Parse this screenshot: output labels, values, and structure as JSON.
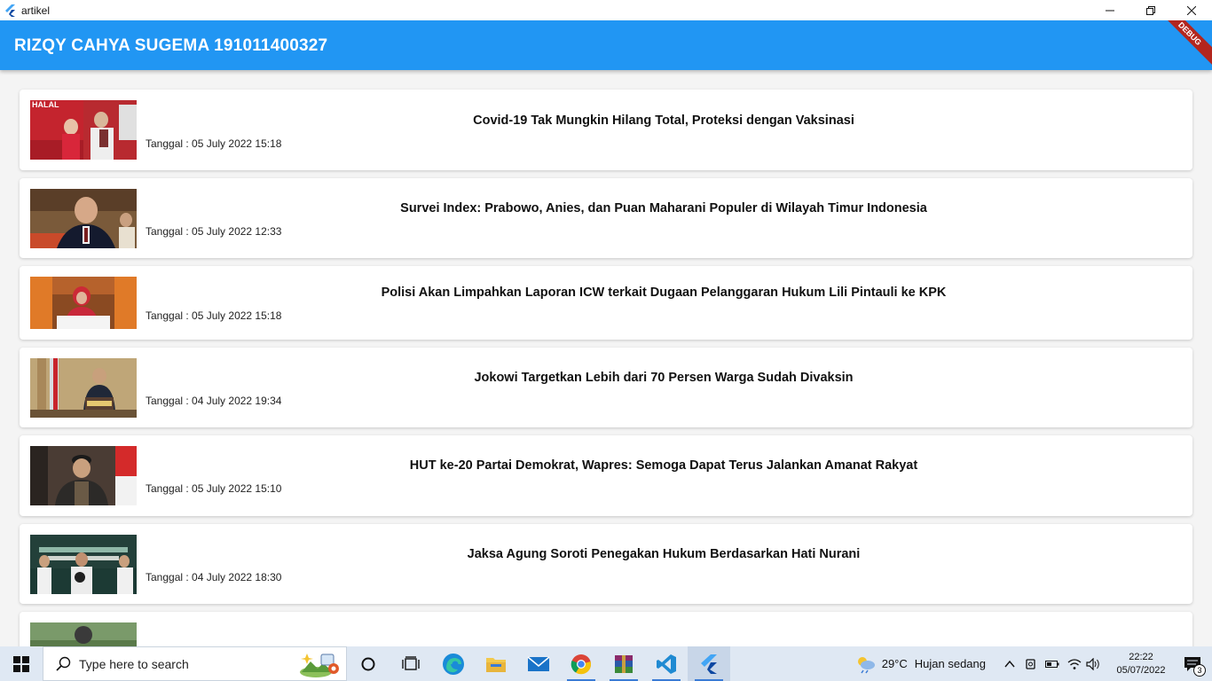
{
  "window": {
    "title": "artikel"
  },
  "appbar": {
    "title": "RIZQY CAHYA SUGEMA 191011400327",
    "debug_label": "DEBUG"
  },
  "articles": [
    {
      "title": "Covid-19 Tak Mungkin Hilang Total, Proteksi dengan Vaksinasi",
      "date": "Tanggal : 05 July 2022 15:18",
      "thumb_text": "HALAL"
    },
    {
      "title": "Survei Index: Prabowo, Anies, dan Puan Maharani Populer di Wilayah Timur Indonesia",
      "date": "Tanggal : 05 July 2022 12:33"
    },
    {
      "title": "Polisi Akan Limpahkan Laporan ICW terkait Dugaan Pelanggaran Hukum Lili Pintauli ke KPK",
      "date": "Tanggal : 05 July 2022 15:18"
    },
    {
      "title": "Jokowi Targetkan Lebih dari 70 Persen Warga Sudah Divaksin",
      "date": "Tanggal : 04 July 2022 19:34"
    },
    {
      "title": "HUT ke-20 Partai Demokrat, Wapres: Semoga Dapat Terus Jalankan Amanat Rakyat",
      "date": "Tanggal : 05 July 2022 15:10"
    },
    {
      "title": "Jaksa Agung Soroti Penegakan Hukum Berdasarkan Hati Nurani",
      "date": "Tanggal : 04 July 2022 18:30"
    },
    {
      "title": "",
      "date": ""
    }
  ],
  "taskbar": {
    "search_placeholder": "Type here to search",
    "weather_temp": "29°C",
    "weather_desc": "Hujan sedang",
    "time": "22:22",
    "date": "05/07/2022",
    "notification_count": "3"
  }
}
